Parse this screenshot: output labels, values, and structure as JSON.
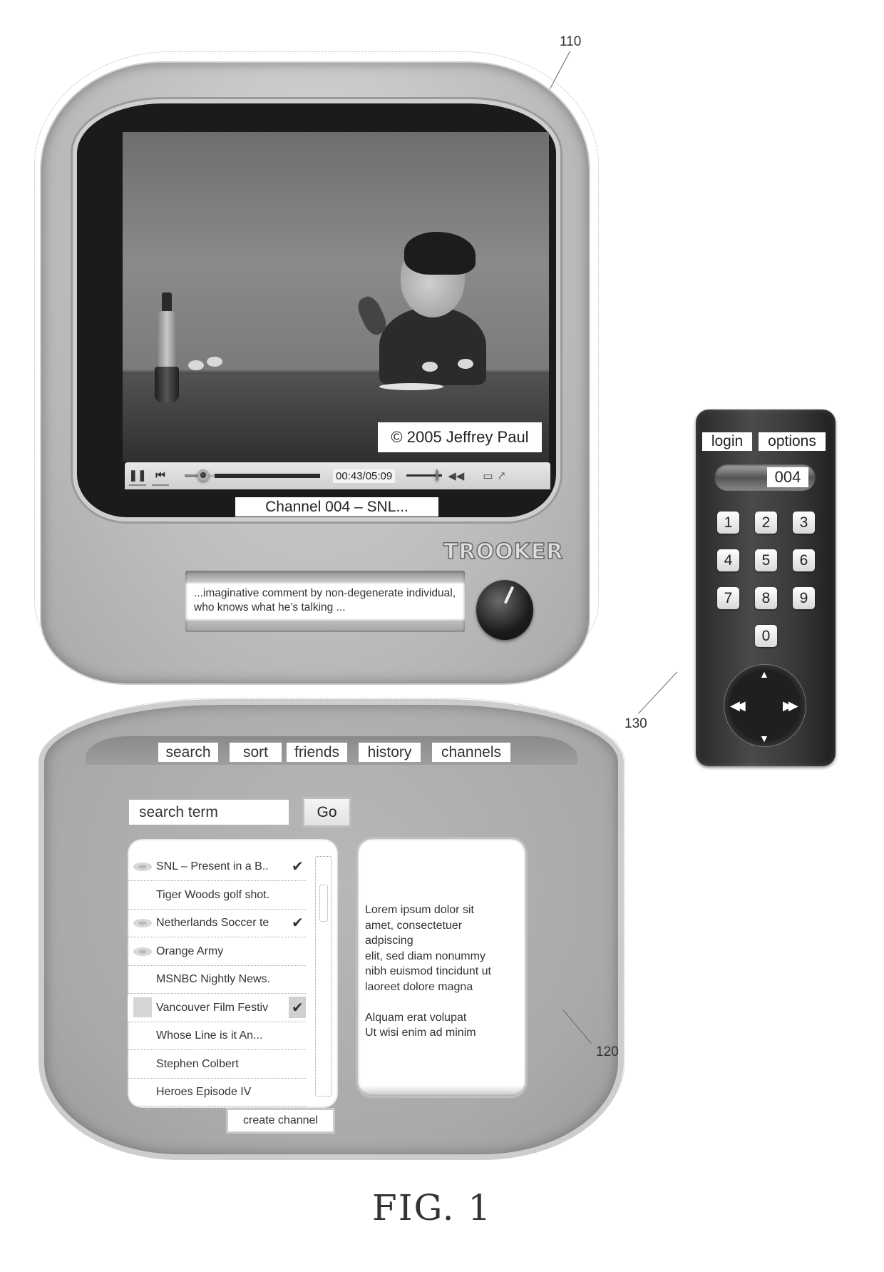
{
  "reference_labels": {
    "tv": "110",
    "panel": "120",
    "remote": "130"
  },
  "tv": {
    "brand": "TROOKER",
    "video": {
      "overlay_caption": "© 2005 Jeffrey Paul"
    },
    "player": {
      "pause_icon": "pause-icon",
      "prev_icon": "skip-back-icon",
      "time_display": "00:43/05:09",
      "progress_fraction": 0.139,
      "volume_fraction": 0.85,
      "mute_icon": "speaker-icon",
      "fullscreen_icon": "fullscreen-icon",
      "popout_icon": "popout-icon"
    },
    "channel_title": "Channel 004 – SNL...",
    "comment": "...imaginative comment by non-degenerate individual, who knows what he’s talking ...",
    "knob_icon": "channel-knob-icon"
  },
  "remote": {
    "login_label": "login",
    "options_label": "options",
    "channel_number": "004",
    "keys": [
      "1",
      "2",
      "3",
      "4",
      "5",
      "6",
      "7",
      "8",
      "9",
      "0"
    ],
    "dpad": {
      "up": "▲",
      "down": "▼",
      "left": "◀◀",
      "right": "▶▶"
    }
  },
  "panel": {
    "tabs": [
      "search",
      "sort",
      "friends",
      "history",
      "channels"
    ],
    "search": {
      "value": "search term",
      "go_label": "Go"
    },
    "results": [
      {
        "title": "SNL – Present in a B..",
        "watched": true,
        "checked": true,
        "selected": false
      },
      {
        "title": "Tiger Woods golf shot.",
        "watched": false,
        "checked": false,
        "selected": false
      },
      {
        "title": "Netherlands Soccer te",
        "watched": true,
        "checked": true,
        "selected": false
      },
      {
        "title": "Orange Army",
        "watched": true,
        "checked": false,
        "selected": false
      },
      {
        "title": "MSNBC Nightly News.",
        "watched": false,
        "checked": false,
        "selected": false
      },
      {
        "title": "Vancouver Film Festiv",
        "watched": false,
        "checked": true,
        "selected": true
      },
      {
        "title": "Whose Line is it An...",
        "watched": false,
        "checked": false,
        "selected": false
      },
      {
        "title": "Stephen Colbert",
        "watched": false,
        "checked": false,
        "selected": false
      },
      {
        "title": "Heroes Episode IV",
        "watched": false,
        "checked": false,
        "selected": false
      }
    ],
    "description": "Lorem ipsum dolor sit\namet, consectetuer\nadpiscing\nelit, sed diam nonummy\nnibh euismod tincidunt ut\nlaoreet dolore magna\n\nAlquam erat volupat\nUt wisi enim ad minim",
    "create_channel_label": "create channel"
  },
  "figure_label": "FIG. 1"
}
